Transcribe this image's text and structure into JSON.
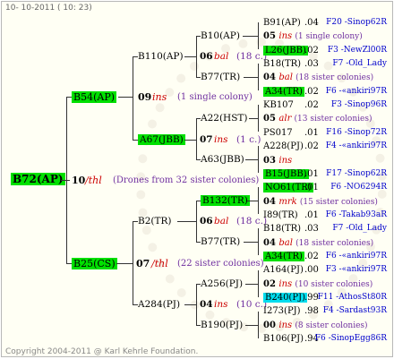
{
  "header": "10- 10-2011 ( 10: 23)",
  "footer": "Copyright 2004-2011 @ Karl Kehrle Foundation.",
  "root": {
    "name": "B72(AP)",
    "year": "10",
    "mark": "/thl",
    "note": "(Drones from 32 sister colonies)"
  },
  "gen1": [
    {
      "name": "B54(AP)",
      "year": "09",
      "mark": "ins",
      "note": "(1 single colony)"
    },
    {
      "name": "B25(CS)",
      "year": "07",
      "mark": "/thl",
      "note": "(22 sister colonies)"
    }
  ],
  "gen2": [
    {
      "name": "B110(AP)",
      "year": "06",
      "mark": "bal",
      "note": "(18 c.)"
    },
    {
      "name": "A67(JBB)",
      "year": "07",
      "mark": "ins",
      "note": "(1 c.)"
    },
    {
      "name": "B2(TR)",
      "year": "06",
      "mark": "bal",
      "note": "(18 c.)"
    },
    {
      "name": "A284(PJ)",
      "year": "04",
      "mark": "ins",
      "note": "(10 c.)"
    }
  ],
  "gen3": [
    {
      "name": "B10(AP)"
    },
    {
      "name": "B77(TR)"
    },
    {
      "name": "A22(HST)"
    },
    {
      "name": "A63(JBB)"
    },
    {
      "name": "B132(TR)"
    },
    {
      "name": "B77(TR)"
    },
    {
      "name": "A256(PJ)"
    },
    {
      "name": "B190(PJ)"
    }
  ],
  "gen4": [
    {
      "name": "B91(AP)",
      "val": ".04",
      "right": "F20 -Sinop62R"
    },
    {
      "mid": "05 ins (1 single colony)"
    },
    {
      "name": "L26(JBB)",
      "val": ".02",
      "right": "F3 -NewZl00R"
    },
    {
      "name": "B18(TR)",
      "val": ".03",
      "right": "F7 -Old_Lady"
    },
    {
      "mid": "04 bal (18 sister colonies)"
    },
    {
      "name": "A34(TR)",
      "val": ".02",
      "right": "F6 -«ankiri97R"
    },
    {
      "name": "KB107",
      "val": ".02",
      "right": "F3 -Sinop96R"
    },
    {
      "mid": "05 alr (13 sister colonies)"
    },
    {
      "name": "PS017",
      "val": ".01",
      "right": "F16 -Sinop72R"
    },
    {
      "name": "A228(PJ)",
      "val": ".02",
      "right": "F4 -«ankiri97R"
    },
    {
      "mid": "03 ins"
    },
    {
      "name": "B15(JBB)",
      "val": ".01",
      "right": "F17 -Sinop62R"
    },
    {
      "name": "NO61(TR)",
      "val": ".01",
      "right": "F6 -NO6294R"
    },
    {
      "mid": "04 mrk (15 sister colonies)"
    },
    {
      "name": "I89(TR)",
      "val": ".01",
      "right": "F6 -Takab93aR"
    },
    {
      "name": "B18(TR)",
      "val": ".03",
      "right": "F7 -Old_Lady"
    },
    {
      "mid": "04 bal (18 sister colonies)"
    },
    {
      "name": "A34(TR)",
      "val": ".02",
      "right": "F6 -«ankiri97R"
    },
    {
      "name": "A164(PJ)",
      "val": ".00",
      "right": "F3 -«ankiri97R"
    },
    {
      "mid": "02 ins (10 sister colonies)"
    },
    {
      "name": "B240(PJ)",
      "val": ".99",
      "right": "F11 -AthosSt80R"
    },
    {
      "name": "I273(PJ)",
      "val": ".98",
      "right": "F4 -Sardast93R"
    },
    {
      "mid": "00 ins (8 sister colonies)"
    },
    {
      "name": "B106(PJ)",
      "val": ".94",
      "right": "F6 -SinopEgg86R"
    }
  ],
  "colors": {
    "highlight_green": "#00e000",
    "highlight_cyan": "#00ddee",
    "blue": "#0000cc",
    "purple": "#7030a0",
    "red": "#cc0000"
  }
}
